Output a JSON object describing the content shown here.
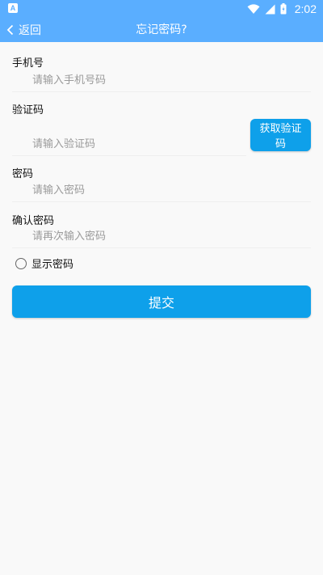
{
  "status_bar": {
    "notification_icon": "a-letter-icon",
    "notification_glyph": "A",
    "icons": [
      "wifi-icon",
      "signal-icon",
      "battery-charging-icon"
    ],
    "time": "2:02"
  },
  "app_bar": {
    "back_label": "返回",
    "title": "忘记密码?"
  },
  "form": {
    "phone_label": "手机号",
    "phone_placeholder": "请输入手机号码",
    "code_label": "验证码",
    "code_placeholder": "请输入验证码",
    "get_code_label": "获取验证码",
    "password_label": "密码",
    "password_placeholder": "请输入密码",
    "confirm_label": "确认密码",
    "confirm_placeholder": "请再次输入密码",
    "show_password_label": "显示密码",
    "submit_label": "提交"
  },
  "colors": {
    "app_bar": "#5aaeff",
    "primary_button": "#0ea0ea",
    "background": "#f9f9f9"
  }
}
